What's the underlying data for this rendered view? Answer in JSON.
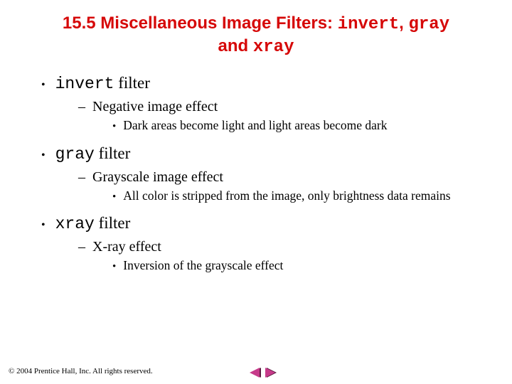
{
  "title": {
    "prefix": "15.5  Miscellaneous Image Filters: ",
    "code1": "invert",
    "sep1": ", ",
    "code2": "gray",
    "mid": " and ",
    "code3": "xray"
  },
  "items": [
    {
      "code": "invert",
      "rest": " filter",
      "sub": "Negative image effect",
      "detail": "Dark areas become light and light areas become dark"
    },
    {
      "code": "gray",
      "rest": " filter",
      "sub": "Grayscale image effect",
      "detail": "All color is stripped from the image, only brightness data remains"
    },
    {
      "code": "xray",
      "rest": " filter",
      "sub": "X-ray effect",
      "detail": "Inversion of the grayscale effect"
    }
  ],
  "footer": "© 2004 Prentice Hall, Inc.  All rights reserved.",
  "bullets": {
    "l1": "•",
    "l2": "–",
    "l3": "•"
  },
  "colors": {
    "accent": "#d60808",
    "navArrow": "#c73a8a",
    "navArrowShadow": "#5a1a3f"
  }
}
